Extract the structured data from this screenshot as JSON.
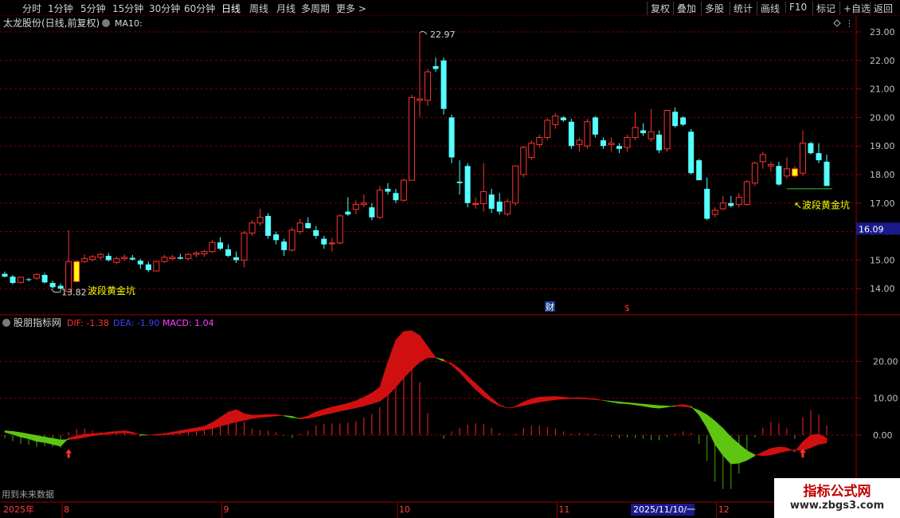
{
  "toolbar": {
    "periods": [
      "分时",
      "1分钟",
      "5分钟",
      "15分钟",
      "30分钟",
      "60分钟",
      "日线",
      "周线",
      "月线",
      "多周期",
      "更多"
    ],
    "active_period": "日线",
    "more_arrow": ">",
    "actions": [
      "复权",
      "叠加",
      "多股",
      "统计",
      "画线",
      "F10",
      "标记",
      "+自选",
      "返回"
    ]
  },
  "main_panel": {
    "title": "太龙股份(日线,前复权)",
    "ma_label": "MA10:",
    "settings_icon": "circle-dropdown-icon",
    "price_ticks": [
      "23.00",
      "22.00",
      "21.00",
      "20.00",
      "19.00",
      "18.00",
      "17.00",
      "16.00",
      "15.00",
      "14.00"
    ],
    "current_price_badge": "16.09",
    "high_marker": "22.97",
    "low_marker": "13.82",
    "signal_label": "波段黄金坑",
    "finance_marker": "财",
    "dollar_marker": "$"
  },
  "sub_panel": {
    "title": "股朋指标网",
    "dif_label": "DIF: -1.38",
    "dea_label": "DEA: -1.90",
    "macd_label": "MACD: 1.04",
    "ticks": [
      "20.00",
      "10.00",
      "0.00"
    ],
    "footnote": "用到未来数据"
  },
  "date_axis": {
    "year_label": "2025年",
    "month_labels": [
      "8",
      "9",
      "10",
      "11",
      "12"
    ],
    "cursor_date": "2025/11/10/一"
  },
  "watermark": {
    "line1": "指标公式网",
    "line2": "www.zbgs3.com"
  },
  "colors": {
    "up": "#ff3232",
    "down": "#54ffff",
    "highlight": "#ffff00",
    "macd_pos": "#ff2020",
    "macd_neg": "#40b000",
    "fill_red": "#d01010",
    "fill_green": "#5ec612",
    "grid": "#7a0000"
  },
  "chart_data": {
    "type": "candlestick",
    "title": "太龙股份(日线,前复权)",
    "price_range": [
      13.5,
      23.3
    ],
    "candles": [
      {
        "o": 14.52,
        "h": 14.6,
        "l": 14.4,
        "c": 14.42
      },
      {
        "o": 14.42,
        "h": 14.48,
        "l": 14.15,
        "c": 14.2
      },
      {
        "o": 14.22,
        "h": 14.42,
        "l": 14.18,
        "c": 14.4
      },
      {
        "o": 14.33,
        "h": 14.38,
        "l": 14.25,
        "c": 14.32
      },
      {
        "o": 14.37,
        "h": 14.53,
        "l": 14.3,
        "c": 14.5
      },
      {
        "o": 14.48,
        "h": 14.55,
        "l": 14.18,
        "c": 14.22
      },
      {
        "o": 14.2,
        "h": 14.28,
        "l": 14.0,
        "c": 14.05
      },
      {
        "o": 14.1,
        "h": 14.18,
        "l": 13.9,
        "c": 14.0
      },
      {
        "o": 13.9,
        "h": 16.05,
        "l": 13.82,
        "c": 14.95
      },
      {
        "o": 14.25,
        "h": 14.98,
        "l": 14.22,
        "c": 14.95,
        "hl": true
      },
      {
        "o": 14.95,
        "h": 15.2,
        "l": 14.9,
        "c": 15.05
      },
      {
        "o": 15.02,
        "h": 15.18,
        "l": 14.95,
        "c": 15.12
      },
      {
        "o": 15.1,
        "h": 15.25,
        "l": 15.0,
        "c": 15.2
      },
      {
        "o": 15.15,
        "h": 15.25,
        "l": 14.95,
        "c": 15.0
      },
      {
        "o": 14.92,
        "h": 15.12,
        "l": 14.85,
        "c": 15.05
      },
      {
        "o": 15.05,
        "h": 15.2,
        "l": 14.98,
        "c": 15.1
      },
      {
        "o": 15.08,
        "h": 15.18,
        "l": 14.98,
        "c": 15.02
      },
      {
        "o": 14.98,
        "h": 15.05,
        "l": 14.7,
        "c": 14.85
      },
      {
        "o": 14.85,
        "h": 14.95,
        "l": 14.58,
        "c": 14.65
      },
      {
        "o": 14.62,
        "h": 14.98,
        "l": 14.6,
        "c": 14.95
      },
      {
        "o": 14.95,
        "h": 15.18,
        "l": 14.9,
        "c": 15.1
      },
      {
        "o": 15.05,
        "h": 15.18,
        "l": 15.0,
        "c": 15.1
      },
      {
        "o": 15.1,
        "h": 15.22,
        "l": 15.02,
        "c": 15.05
      },
      {
        "o": 15.05,
        "h": 15.25,
        "l": 15.0,
        "c": 15.2
      },
      {
        "o": 15.2,
        "h": 15.3,
        "l": 15.1,
        "c": 15.25
      },
      {
        "o": 15.22,
        "h": 15.35,
        "l": 15.12,
        "c": 15.3
      },
      {
        "o": 15.3,
        "h": 15.7,
        "l": 15.25,
        "c": 15.62
      },
      {
        "o": 15.62,
        "h": 15.8,
        "l": 15.35,
        "c": 15.4
      },
      {
        "o": 15.38,
        "h": 15.55,
        "l": 15.1,
        "c": 15.15
      },
      {
        "o": 15.1,
        "h": 15.3,
        "l": 14.9,
        "c": 15.0
      },
      {
        "o": 15.0,
        "h": 16.02,
        "l": 14.75,
        "c": 15.95
      },
      {
        "o": 15.95,
        "h": 16.4,
        "l": 15.85,
        "c": 16.3
      },
      {
        "o": 16.3,
        "h": 16.8,
        "l": 16.2,
        "c": 16.5
      },
      {
        "o": 16.55,
        "h": 16.65,
        "l": 15.75,
        "c": 15.85
      },
      {
        "o": 15.9,
        "h": 16.0,
        "l": 15.55,
        "c": 15.7
      },
      {
        "o": 15.65,
        "h": 15.75,
        "l": 15.15,
        "c": 15.35
      },
      {
        "o": 15.35,
        "h": 16.15,
        "l": 15.3,
        "c": 16.05
      },
      {
        "o": 16.0,
        "h": 16.45,
        "l": 15.9,
        "c": 16.3
      },
      {
        "o": 16.3,
        "h": 16.5,
        "l": 16.1,
        "c": 16.12
      },
      {
        "o": 16.05,
        "h": 16.2,
        "l": 15.75,
        "c": 15.85
      },
      {
        "o": 15.75,
        "h": 15.85,
        "l": 15.4,
        "c": 15.55
      },
      {
        "o": 15.6,
        "h": 15.78,
        "l": 15.3,
        "c": 15.6
      },
      {
        "o": 15.6,
        "h": 16.6,
        "l": 15.55,
        "c": 16.55
      },
      {
        "o": 16.7,
        "h": 17.2,
        "l": 16.55,
        "c": 16.6
      },
      {
        "o": 16.78,
        "h": 17.1,
        "l": 16.6,
        "c": 16.95
      },
      {
        "o": 16.95,
        "h": 17.3,
        "l": 16.85,
        "c": 17.0
      },
      {
        "o": 16.85,
        "h": 17.0,
        "l": 16.4,
        "c": 16.5
      },
      {
        "o": 16.5,
        "h": 17.6,
        "l": 16.45,
        "c": 17.45
      },
      {
        "o": 17.5,
        "h": 17.7,
        "l": 17.3,
        "c": 17.4
      },
      {
        "o": 17.35,
        "h": 17.5,
        "l": 17.0,
        "c": 17.1
      },
      {
        "o": 17.1,
        "h": 17.85,
        "l": 17.05,
        "c": 17.8
      },
      {
        "o": 17.8,
        "h": 20.8,
        "l": 17.85,
        "c": 20.7
      },
      {
        "o": 20.6,
        "h": 22.97,
        "l": 20.0,
        "c": 20.65
      },
      {
        "o": 20.6,
        "h": 21.7,
        "l": 20.4,
        "c": 21.6
      },
      {
        "o": 21.8,
        "h": 22.1,
        "l": 21.6,
        "c": 21.7
      },
      {
        "o": 22.0,
        "h": 22.1,
        "l": 20.1,
        "c": 20.3
      },
      {
        "o": 20.0,
        "h": 20.1,
        "l": 18.4,
        "c": 18.6
      },
      {
        "o": 17.75,
        "h": 18.5,
        "l": 17.3,
        "c": 17.7
      },
      {
        "o": 18.3,
        "h": 18.4,
        "l": 16.85,
        "c": 17.0
      },
      {
        "o": 16.95,
        "h": 17.2,
        "l": 16.8,
        "c": 16.98
      },
      {
        "o": 16.98,
        "h": 18.4,
        "l": 16.7,
        "c": 17.4
      },
      {
        "o": 17.3,
        "h": 17.5,
        "l": 16.65,
        "c": 16.8
      },
      {
        "o": 17.05,
        "h": 17.35,
        "l": 16.6,
        "c": 16.7
      },
      {
        "o": 16.62,
        "h": 17.15,
        "l": 16.55,
        "c": 17.05
      },
      {
        "o": 17.0,
        "h": 18.3,
        "l": 16.9,
        "c": 18.3
      },
      {
        "o": 18.0,
        "h": 19.0,
        "l": 17.9,
        "c": 18.95
      },
      {
        "o": 18.6,
        "h": 19.2,
        "l": 18.5,
        "c": 19.1
      },
      {
        "o": 19.05,
        "h": 19.4,
        "l": 18.95,
        "c": 19.3
      },
      {
        "o": 19.3,
        "h": 19.98,
        "l": 19.2,
        "c": 19.9
      },
      {
        "o": 19.75,
        "h": 20.15,
        "l": 19.6,
        "c": 20.05
      },
      {
        "o": 20.0,
        "h": 20.05,
        "l": 19.85,
        "c": 19.9
      },
      {
        "o": 19.85,
        "h": 19.95,
        "l": 18.9,
        "c": 19.0
      },
      {
        "o": 19.05,
        "h": 19.3,
        "l": 18.8,
        "c": 19.2
      },
      {
        "o": 19.0,
        "h": 19.95,
        "l": 18.9,
        "c": 19.85
      },
      {
        "o": 20.0,
        "h": 20.05,
        "l": 19.3,
        "c": 19.4
      },
      {
        "o": 19.2,
        "h": 19.3,
        "l": 18.9,
        "c": 19.0
      },
      {
        "o": 19.05,
        "h": 19.3,
        "l": 18.8,
        "c": 19.1
      },
      {
        "o": 19.0,
        "h": 19.1,
        "l": 18.75,
        "c": 18.9
      },
      {
        "o": 18.95,
        "h": 19.4,
        "l": 18.8,
        "c": 19.3
      },
      {
        "o": 19.3,
        "h": 20.2,
        "l": 19.2,
        "c": 19.65
      },
      {
        "o": 19.55,
        "h": 19.8,
        "l": 19.35,
        "c": 19.45
      },
      {
        "o": 19.25,
        "h": 20.3,
        "l": 19.15,
        "c": 19.5
      },
      {
        "o": 19.4,
        "h": 19.55,
        "l": 18.75,
        "c": 18.85
      },
      {
        "o": 18.9,
        "h": 20.25,
        "l": 18.8,
        "c": 20.25
      },
      {
        "o": 20.2,
        "h": 20.35,
        "l": 19.65,
        "c": 19.7
      },
      {
        "o": 20.0,
        "h": 20.05,
        "l": 19.7,
        "c": 19.75
      },
      {
        "o": 19.5,
        "h": 19.6,
        "l": 18.0,
        "c": 18.05
      },
      {
        "o": 18.5,
        "h": 18.55,
        "l": 17.8,
        "c": 17.8
      },
      {
        "o": 17.5,
        "h": 17.9,
        "l": 16.4,
        "c": 16.45
      },
      {
        "o": 16.6,
        "h": 16.85,
        "l": 16.5,
        "c": 16.75
      },
      {
        "o": 16.8,
        "h": 17.25,
        "l": 16.75,
        "c": 17.0
      },
      {
        "o": 17.0,
        "h": 17.25,
        "l": 16.85,
        "c": 16.9
      },
      {
        "o": 16.95,
        "h": 17.35,
        "l": 16.85,
        "c": 17.2
      },
      {
        "o": 16.95,
        "h": 17.8,
        "l": 16.9,
        "c": 17.75
      },
      {
        "o": 17.7,
        "h": 18.45,
        "l": 17.6,
        "c": 18.4
      },
      {
        "o": 18.45,
        "h": 18.8,
        "l": 18.2,
        "c": 18.7
      },
      {
        "o": 18.3,
        "h": 18.45,
        "l": 18.1,
        "c": 18.35
      },
      {
        "o": 18.3,
        "h": 18.45,
        "l": 17.6,
        "c": 17.65
      },
      {
        "o": 17.95,
        "h": 18.6,
        "l": 17.85,
        "c": 18.2
      },
      {
        "o": 17.95,
        "h": 18.3,
        "l": 17.9,
        "c": 18.2,
        "hl": true
      },
      {
        "o": 18.05,
        "h": 19.55,
        "l": 17.95,
        "c": 19.1
      },
      {
        "o": 19.1,
        "h": 19.15,
        "l": 18.7,
        "c": 18.75
      },
      {
        "o": 18.75,
        "h": 19.1,
        "l": 18.4,
        "c": 18.5
      },
      {
        "o": 18.45,
        "h": 18.7,
        "l": 17.6,
        "c": 17.6
      }
    ],
    "macd": {
      "dif": [
        0.8,
        0.2,
        -0.5,
        -1.0,
        -1.7,
        -2.0,
        -2.5,
        -3.0,
        -0.8,
        -0.2,
        0.3,
        0.4,
        0.5,
        0.8,
        1.0,
        1.2,
        0.8,
        0.0,
        0.0,
        0.2,
        0.4,
        0.8,
        1.2,
        1.6,
        2.0,
        2.4,
        3.4,
        4.8,
        6.2,
        6.9,
        5.8,
        5.4,
        5.5,
        5.6,
        5.6,
        5.2,
        4.7,
        4.6,
        5.2,
        6.3,
        7.0,
        7.6,
        8.1,
        8.6,
        9.3,
        10.3,
        11.4,
        13.0,
        19.8,
        25.8,
        28.1,
        28.3,
        27.0,
        24.0,
        21.0,
        20.0,
        19.5,
        18.0,
        16.0,
        14.0,
        12.0,
        10.0,
        8.2,
        7.4,
        7.8,
        9.0,
        9.8,
        10.3,
        10.4,
        10.5,
        10.3,
        10.1,
        10.2,
        10.0,
        9.8,
        9.4,
        9.0,
        8.6,
        8.5,
        8.2,
        7.9,
        7.5,
        7.3,
        7.6,
        8.0,
        8.3,
        7.8,
        5.5,
        2.0,
        -2.5,
        -5.5,
        -7.8,
        -7.6,
        -6.8,
        -5.6,
        -4.6,
        -3.6,
        -3.2,
        -3.4,
        -4.5,
        -1.8,
        0.0,
        0.3,
        -0.8,
        -1.38
      ],
      "dea": [
        1.2,
        1.0,
        0.7,
        0.3,
        -0.1,
        -0.5,
        -0.9,
        -1.3,
        -1.2,
        -1.0,
        -0.6,
        -0.2,
        0.1,
        0.3,
        0.5,
        0.6,
        0.4,
        0.2,
        0.0,
        0.0,
        0.1,
        0.3,
        0.5,
        0.8,
        1.1,
        1.4,
        1.8,
        2.4,
        3.0,
        3.6,
        4.0,
        4.5,
        4.8,
        5.0,
        5.2,
        5.3,
        5.1,
        4.4,
        4.6,
        5.0,
        5.5,
        6.0,
        6.5,
        6.9,
        7.4,
        7.9,
        8.5,
        9.2,
        10.8,
        13.0,
        15.5,
        17.8,
        19.8,
        21.0,
        21.0,
        20.5,
        19.0,
        17.0,
        14.6,
        12.4,
        10.5,
        9.0,
        7.9,
        7.4,
        7.6,
        8.0,
        8.5,
        9.0,
        9.3,
        9.6,
        9.8,
        9.9,
        9.9,
        9.8,
        9.6,
        9.4,
        9.2,
        9.0,
        8.8,
        8.6,
        8.4,
        8.2,
        8.0,
        7.9,
        7.8,
        7.8,
        7.5,
        6.7,
        5.5,
        3.8,
        1.8,
        -0.5,
        -2.4,
        -4.2,
        -5.3,
        -5.6,
        -5.4,
        -4.8,
        -4.3,
        -4.0,
        -4.2,
        -3.4,
        -2.5,
        -2.1,
        -1.9
      ]
    },
    "macd_range": [
      -17,
      29
    ]
  }
}
